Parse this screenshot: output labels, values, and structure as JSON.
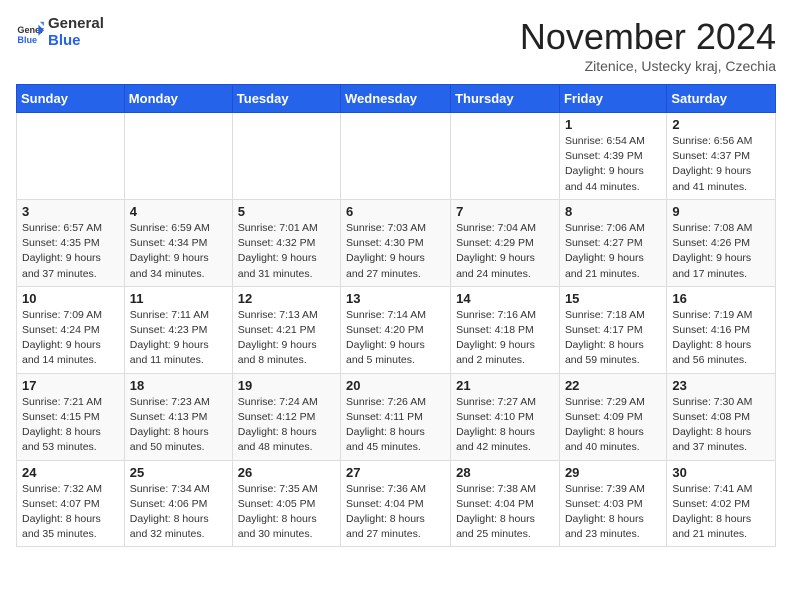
{
  "header": {
    "logo_general": "General",
    "logo_blue": "Blue",
    "month_title": "November 2024",
    "location": "Zitenice, Ustecky kraj, Czechia"
  },
  "weekdays": [
    "Sunday",
    "Monday",
    "Tuesday",
    "Wednesday",
    "Thursday",
    "Friday",
    "Saturday"
  ],
  "weeks": [
    [
      {
        "day": "",
        "info": ""
      },
      {
        "day": "",
        "info": ""
      },
      {
        "day": "",
        "info": ""
      },
      {
        "day": "",
        "info": ""
      },
      {
        "day": "",
        "info": ""
      },
      {
        "day": "1",
        "info": "Sunrise: 6:54 AM\nSunset: 4:39 PM\nDaylight: 9 hours and 44 minutes."
      },
      {
        "day": "2",
        "info": "Sunrise: 6:56 AM\nSunset: 4:37 PM\nDaylight: 9 hours and 41 minutes."
      }
    ],
    [
      {
        "day": "3",
        "info": "Sunrise: 6:57 AM\nSunset: 4:35 PM\nDaylight: 9 hours and 37 minutes."
      },
      {
        "day": "4",
        "info": "Sunrise: 6:59 AM\nSunset: 4:34 PM\nDaylight: 9 hours and 34 minutes."
      },
      {
        "day": "5",
        "info": "Sunrise: 7:01 AM\nSunset: 4:32 PM\nDaylight: 9 hours and 31 minutes."
      },
      {
        "day": "6",
        "info": "Sunrise: 7:03 AM\nSunset: 4:30 PM\nDaylight: 9 hours and 27 minutes."
      },
      {
        "day": "7",
        "info": "Sunrise: 7:04 AM\nSunset: 4:29 PM\nDaylight: 9 hours and 24 minutes."
      },
      {
        "day": "8",
        "info": "Sunrise: 7:06 AM\nSunset: 4:27 PM\nDaylight: 9 hours and 21 minutes."
      },
      {
        "day": "9",
        "info": "Sunrise: 7:08 AM\nSunset: 4:26 PM\nDaylight: 9 hours and 17 minutes."
      }
    ],
    [
      {
        "day": "10",
        "info": "Sunrise: 7:09 AM\nSunset: 4:24 PM\nDaylight: 9 hours and 14 minutes."
      },
      {
        "day": "11",
        "info": "Sunrise: 7:11 AM\nSunset: 4:23 PM\nDaylight: 9 hours and 11 minutes."
      },
      {
        "day": "12",
        "info": "Sunrise: 7:13 AM\nSunset: 4:21 PM\nDaylight: 9 hours and 8 minutes."
      },
      {
        "day": "13",
        "info": "Sunrise: 7:14 AM\nSunset: 4:20 PM\nDaylight: 9 hours and 5 minutes."
      },
      {
        "day": "14",
        "info": "Sunrise: 7:16 AM\nSunset: 4:18 PM\nDaylight: 9 hours and 2 minutes."
      },
      {
        "day": "15",
        "info": "Sunrise: 7:18 AM\nSunset: 4:17 PM\nDaylight: 8 hours and 59 minutes."
      },
      {
        "day": "16",
        "info": "Sunrise: 7:19 AM\nSunset: 4:16 PM\nDaylight: 8 hours and 56 minutes."
      }
    ],
    [
      {
        "day": "17",
        "info": "Sunrise: 7:21 AM\nSunset: 4:15 PM\nDaylight: 8 hours and 53 minutes."
      },
      {
        "day": "18",
        "info": "Sunrise: 7:23 AM\nSunset: 4:13 PM\nDaylight: 8 hours and 50 minutes."
      },
      {
        "day": "19",
        "info": "Sunrise: 7:24 AM\nSunset: 4:12 PM\nDaylight: 8 hours and 48 minutes."
      },
      {
        "day": "20",
        "info": "Sunrise: 7:26 AM\nSunset: 4:11 PM\nDaylight: 8 hours and 45 minutes."
      },
      {
        "day": "21",
        "info": "Sunrise: 7:27 AM\nSunset: 4:10 PM\nDaylight: 8 hours and 42 minutes."
      },
      {
        "day": "22",
        "info": "Sunrise: 7:29 AM\nSunset: 4:09 PM\nDaylight: 8 hours and 40 minutes."
      },
      {
        "day": "23",
        "info": "Sunrise: 7:30 AM\nSunset: 4:08 PM\nDaylight: 8 hours and 37 minutes."
      }
    ],
    [
      {
        "day": "24",
        "info": "Sunrise: 7:32 AM\nSunset: 4:07 PM\nDaylight: 8 hours and 35 minutes."
      },
      {
        "day": "25",
        "info": "Sunrise: 7:34 AM\nSunset: 4:06 PM\nDaylight: 8 hours and 32 minutes."
      },
      {
        "day": "26",
        "info": "Sunrise: 7:35 AM\nSunset: 4:05 PM\nDaylight: 8 hours and 30 minutes."
      },
      {
        "day": "27",
        "info": "Sunrise: 7:36 AM\nSunset: 4:04 PM\nDaylight: 8 hours and 27 minutes."
      },
      {
        "day": "28",
        "info": "Sunrise: 7:38 AM\nSunset: 4:04 PM\nDaylight: 8 hours and 25 minutes."
      },
      {
        "day": "29",
        "info": "Sunrise: 7:39 AM\nSunset: 4:03 PM\nDaylight: 8 hours and 23 minutes."
      },
      {
        "day": "30",
        "info": "Sunrise: 7:41 AM\nSunset: 4:02 PM\nDaylight: 8 hours and 21 minutes."
      }
    ]
  ]
}
